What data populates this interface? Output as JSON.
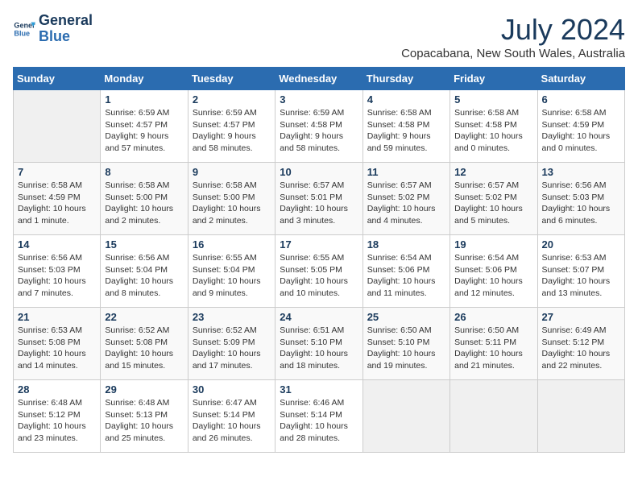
{
  "logo": {
    "name": "GeneralBlue",
    "line1": "General",
    "line2": "Blue"
  },
  "title": "July 2024",
  "subtitle": "Copacabana, New South Wales, Australia",
  "header": {
    "days": [
      "Sunday",
      "Monday",
      "Tuesday",
      "Wednesday",
      "Thursday",
      "Friday",
      "Saturday"
    ]
  },
  "weeks": [
    [
      {
        "day": "",
        "info": ""
      },
      {
        "day": "1",
        "info": "Sunrise: 6:59 AM\nSunset: 4:57 PM\nDaylight: 9 hours\nand 57 minutes."
      },
      {
        "day": "2",
        "info": "Sunrise: 6:59 AM\nSunset: 4:57 PM\nDaylight: 9 hours\nand 58 minutes."
      },
      {
        "day": "3",
        "info": "Sunrise: 6:59 AM\nSunset: 4:58 PM\nDaylight: 9 hours\nand 58 minutes."
      },
      {
        "day": "4",
        "info": "Sunrise: 6:58 AM\nSunset: 4:58 PM\nDaylight: 9 hours\nand 59 minutes."
      },
      {
        "day": "5",
        "info": "Sunrise: 6:58 AM\nSunset: 4:58 PM\nDaylight: 10 hours\nand 0 minutes."
      },
      {
        "day": "6",
        "info": "Sunrise: 6:58 AM\nSunset: 4:59 PM\nDaylight: 10 hours\nand 0 minutes."
      }
    ],
    [
      {
        "day": "7",
        "info": "Sunrise: 6:58 AM\nSunset: 4:59 PM\nDaylight: 10 hours\nand 1 minute."
      },
      {
        "day": "8",
        "info": "Sunrise: 6:58 AM\nSunset: 5:00 PM\nDaylight: 10 hours\nand 2 minutes."
      },
      {
        "day": "9",
        "info": "Sunrise: 6:58 AM\nSunset: 5:00 PM\nDaylight: 10 hours\nand 2 minutes."
      },
      {
        "day": "10",
        "info": "Sunrise: 6:57 AM\nSunset: 5:01 PM\nDaylight: 10 hours\nand 3 minutes."
      },
      {
        "day": "11",
        "info": "Sunrise: 6:57 AM\nSunset: 5:02 PM\nDaylight: 10 hours\nand 4 minutes."
      },
      {
        "day": "12",
        "info": "Sunrise: 6:57 AM\nSunset: 5:02 PM\nDaylight: 10 hours\nand 5 minutes."
      },
      {
        "day": "13",
        "info": "Sunrise: 6:56 AM\nSunset: 5:03 PM\nDaylight: 10 hours\nand 6 minutes."
      }
    ],
    [
      {
        "day": "14",
        "info": "Sunrise: 6:56 AM\nSunset: 5:03 PM\nDaylight: 10 hours\nand 7 minutes."
      },
      {
        "day": "15",
        "info": "Sunrise: 6:56 AM\nSunset: 5:04 PM\nDaylight: 10 hours\nand 8 minutes."
      },
      {
        "day": "16",
        "info": "Sunrise: 6:55 AM\nSunset: 5:04 PM\nDaylight: 10 hours\nand 9 minutes."
      },
      {
        "day": "17",
        "info": "Sunrise: 6:55 AM\nSunset: 5:05 PM\nDaylight: 10 hours\nand 10 minutes."
      },
      {
        "day": "18",
        "info": "Sunrise: 6:54 AM\nSunset: 5:06 PM\nDaylight: 10 hours\nand 11 minutes."
      },
      {
        "day": "19",
        "info": "Sunrise: 6:54 AM\nSunset: 5:06 PM\nDaylight: 10 hours\nand 12 minutes."
      },
      {
        "day": "20",
        "info": "Sunrise: 6:53 AM\nSunset: 5:07 PM\nDaylight: 10 hours\nand 13 minutes."
      }
    ],
    [
      {
        "day": "21",
        "info": "Sunrise: 6:53 AM\nSunset: 5:08 PM\nDaylight: 10 hours\nand 14 minutes."
      },
      {
        "day": "22",
        "info": "Sunrise: 6:52 AM\nSunset: 5:08 PM\nDaylight: 10 hours\nand 15 minutes."
      },
      {
        "day": "23",
        "info": "Sunrise: 6:52 AM\nSunset: 5:09 PM\nDaylight: 10 hours\nand 17 minutes."
      },
      {
        "day": "24",
        "info": "Sunrise: 6:51 AM\nSunset: 5:10 PM\nDaylight: 10 hours\nand 18 minutes."
      },
      {
        "day": "25",
        "info": "Sunrise: 6:50 AM\nSunset: 5:10 PM\nDaylight: 10 hours\nand 19 minutes."
      },
      {
        "day": "26",
        "info": "Sunrise: 6:50 AM\nSunset: 5:11 PM\nDaylight: 10 hours\nand 21 minutes."
      },
      {
        "day": "27",
        "info": "Sunrise: 6:49 AM\nSunset: 5:12 PM\nDaylight: 10 hours\nand 22 minutes."
      }
    ],
    [
      {
        "day": "28",
        "info": "Sunrise: 6:48 AM\nSunset: 5:12 PM\nDaylight: 10 hours\nand 23 minutes."
      },
      {
        "day": "29",
        "info": "Sunrise: 6:48 AM\nSunset: 5:13 PM\nDaylight: 10 hours\nand 25 minutes."
      },
      {
        "day": "30",
        "info": "Sunrise: 6:47 AM\nSunset: 5:14 PM\nDaylight: 10 hours\nand 26 minutes."
      },
      {
        "day": "31",
        "info": "Sunrise: 6:46 AM\nSunset: 5:14 PM\nDaylight: 10 hours\nand 28 minutes."
      },
      {
        "day": "",
        "info": ""
      },
      {
        "day": "",
        "info": ""
      },
      {
        "day": "",
        "info": ""
      }
    ]
  ]
}
